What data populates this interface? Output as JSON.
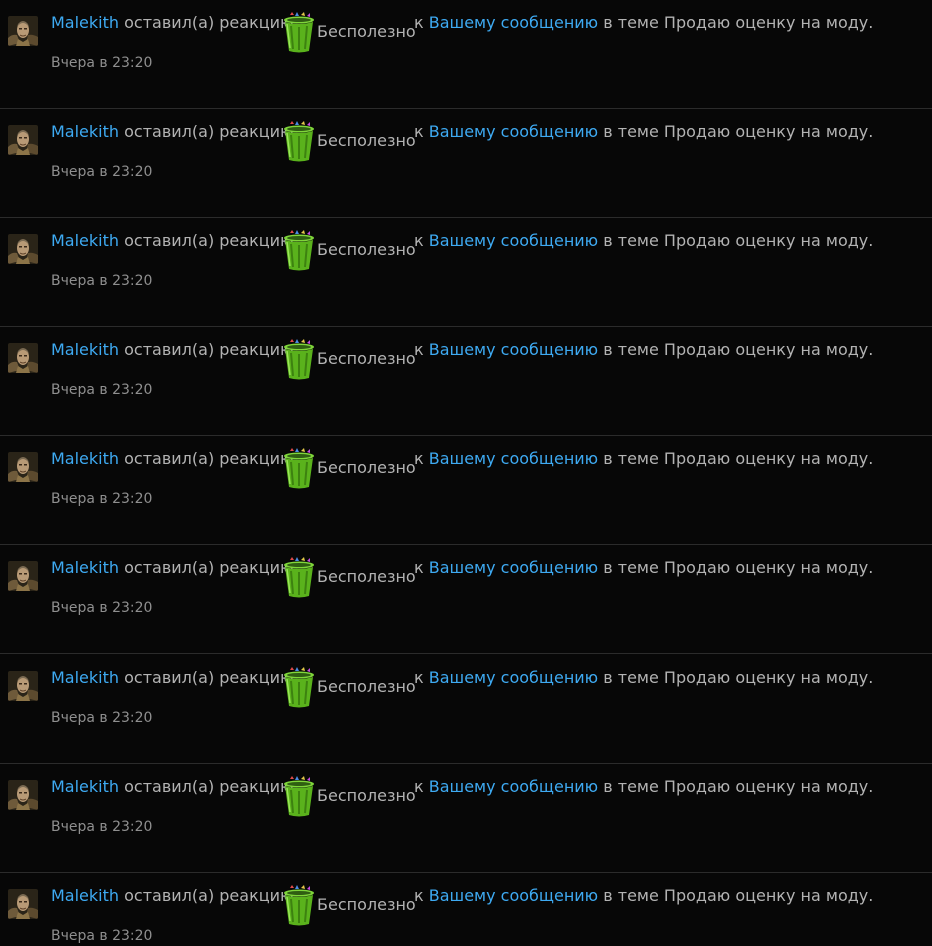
{
  "colors": {
    "background": "#070707",
    "link": "#3eaaf2",
    "text": "#b3b3b3",
    "muted": "#8f8f8f",
    "divider": "#2b2b2b",
    "trash_green": "#5ab21c"
  },
  "notifications": [
    {
      "user": "Malekith",
      "action": "оставил(а) реакцию",
      "reaction": "Бесполезно",
      "reaction_icon": "trash-can-icon",
      "prefix": "к",
      "target": "Вашему сообщению",
      "suffix": "в теме Продаю оценку на моду.",
      "time": "Вчера в 23:20"
    },
    {
      "user": "Malekith",
      "action": "оставил(а) реакцию",
      "reaction": "Бесполезно",
      "reaction_icon": "trash-can-icon",
      "prefix": "к",
      "target": "Вашему сообщению",
      "suffix": "в теме Продаю оценку на моду.",
      "time": "Вчера в 23:20"
    },
    {
      "user": "Malekith",
      "action": "оставил(а) реакцию",
      "reaction": "Бесполезно",
      "reaction_icon": "trash-can-icon",
      "prefix": "к",
      "target": "Вашему сообщению",
      "suffix": "в теме Продаю оценку на моду.",
      "time": "Вчера в 23:20"
    },
    {
      "user": "Malekith",
      "action": "оставил(а) реакцию",
      "reaction": "Бесполезно",
      "reaction_icon": "trash-can-icon",
      "prefix": "к",
      "target": "Вашему сообщению",
      "suffix": "в теме Продаю оценку на моду.",
      "time": "Вчера в 23:20"
    },
    {
      "user": "Malekith",
      "action": "оставил(а) реакцию",
      "reaction": "Бесполезно",
      "reaction_icon": "trash-can-icon",
      "prefix": "к",
      "target": "Вашему сообщению",
      "suffix": "в теме Продаю оценку на моду.",
      "time": "Вчера в 23:20"
    },
    {
      "user": "Malekith",
      "action": "оставил(а) реакцию",
      "reaction": "Бесполезно",
      "reaction_icon": "trash-can-icon",
      "prefix": "к",
      "target": "Вашему сообщению",
      "suffix": "в теме Продаю оценку на моду.",
      "time": "Вчера в 23:20"
    },
    {
      "user": "Malekith",
      "action": "оставил(а) реакцию",
      "reaction": "Бесполезно",
      "reaction_icon": "trash-can-icon",
      "prefix": "к",
      "target": "Вашему сообщению",
      "suffix": "в теме Продаю оценку на моду.",
      "time": "Вчера в 23:20"
    },
    {
      "user": "Malekith",
      "action": "оставил(а) реакцию",
      "reaction": "Бесполезно",
      "reaction_icon": "trash-can-icon",
      "prefix": "к",
      "target": "Вашему сообщению",
      "suffix": "в теме Продаю оценку на моду.",
      "time": "Вчера в 23:20"
    },
    {
      "user": "Malekith",
      "action": "оставил(а) реакцию",
      "reaction": "Бесполезно",
      "reaction_icon": "trash-can-icon",
      "prefix": "к",
      "target": "Вашему сообщению",
      "suffix": "в теме Продаю оценку на моду.",
      "time": "Вчера в 23:20"
    }
  ]
}
